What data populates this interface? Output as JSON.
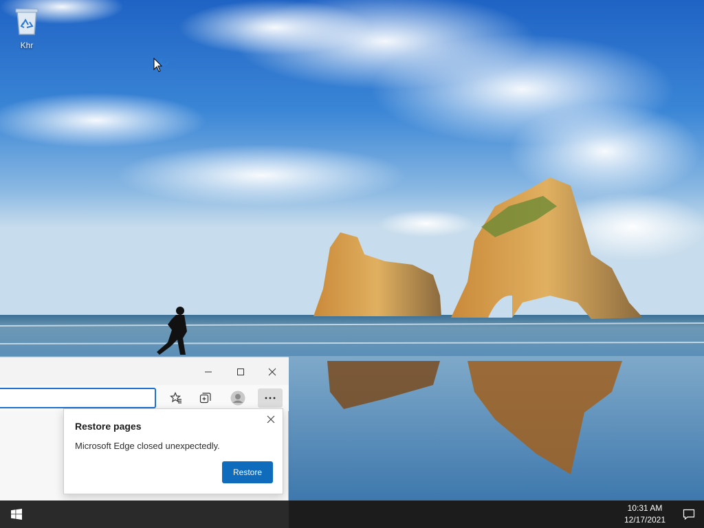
{
  "desktop": {
    "icons": [
      {
        "label": "Khr",
        "icon": "recycle-bin-icon"
      }
    ]
  },
  "edge": {
    "window_controls": {
      "minimize_icon": "minimize-icon",
      "maximize_icon": "maximize-icon",
      "close_icon": "close-icon"
    },
    "toolbar": {
      "favorites_icon": "favorites-icon",
      "collections_icon": "collections-icon",
      "profile_icon": "profile-icon",
      "more_icon": "more-icon"
    },
    "restore_popup": {
      "title": "Restore pages",
      "message": "Microsoft Edge closed unexpectedly.",
      "button": "Restore",
      "accent": "#0f6cbd"
    }
  },
  "taskbar": {
    "time": "10:31 AM",
    "date": "12/17/2021",
    "start_icon": "windows-logo-icon",
    "notification_icon": "action-center-icon"
  }
}
